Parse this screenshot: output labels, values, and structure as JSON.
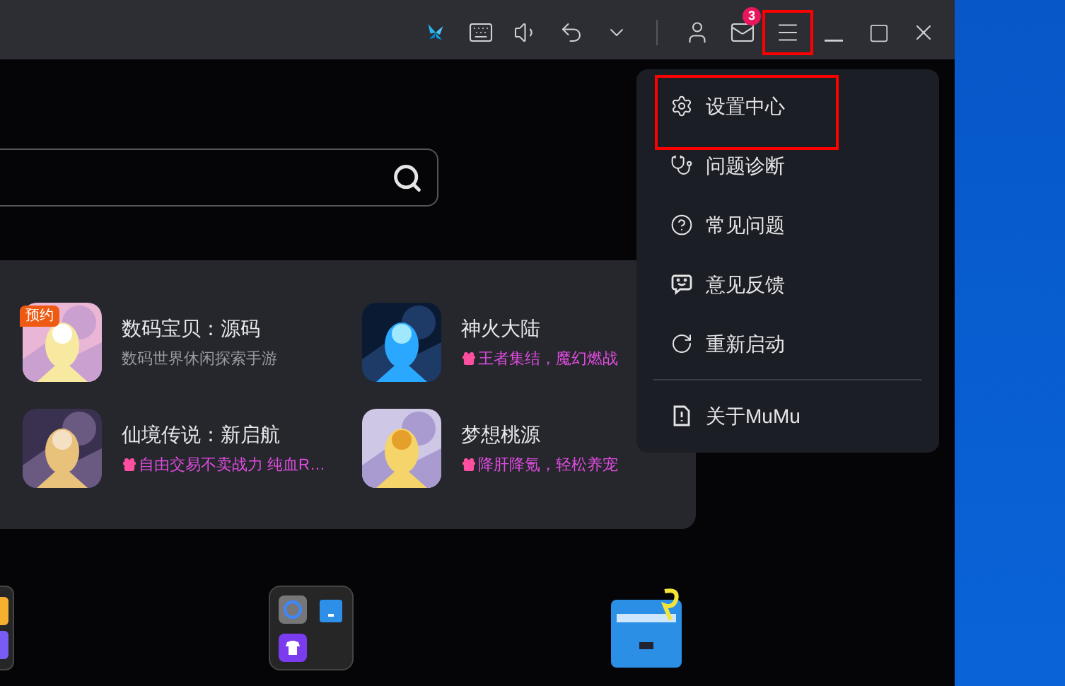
{
  "title_bar": {
    "buttons": [
      {
        "kind": "butterfly"
      },
      {
        "kind": "keyboard"
      },
      {
        "kind": "volume"
      },
      {
        "kind": "undo"
      },
      {
        "kind": "chevron"
      },
      {
        "kind": "divider"
      },
      {
        "kind": "user"
      },
      {
        "kind": "mail",
        "badge": "3"
      },
      {
        "kind": "menu",
        "highlighted": true
      },
      {
        "kind": "minimize"
      },
      {
        "kind": "maximize"
      },
      {
        "kind": "close"
      }
    ]
  },
  "games": [
    {
      "title": "数码宝贝：源码",
      "subtitle": "数码世界休闲探索手游",
      "kind": "plain",
      "badge": "预约"
    },
    {
      "title": "神火大陆",
      "subtitle": "王者集结，魔幻燃战",
      "kind": "gift"
    },
    {
      "title": "仙境传说：新启航",
      "subtitle": "自由交易不卖战力 纯血R…",
      "kind": "gift"
    },
    {
      "title": "梦想桃源",
      "subtitle": "降肝降氪，轻松养宠",
      "kind": "gift"
    }
  ],
  "menu": {
    "items": [
      {
        "label": "设置中心",
        "highlighted": true
      },
      {
        "label": "问题诊断",
        "highlighted": false
      },
      {
        "label": "常见问题",
        "highlighted": false
      },
      {
        "label": "意见反馈",
        "highlighted": false
      },
      {
        "label": "重新启动",
        "highlighted": false
      },
      {
        "label": "关于MuMu",
        "highlighted": false
      }
    ]
  }
}
